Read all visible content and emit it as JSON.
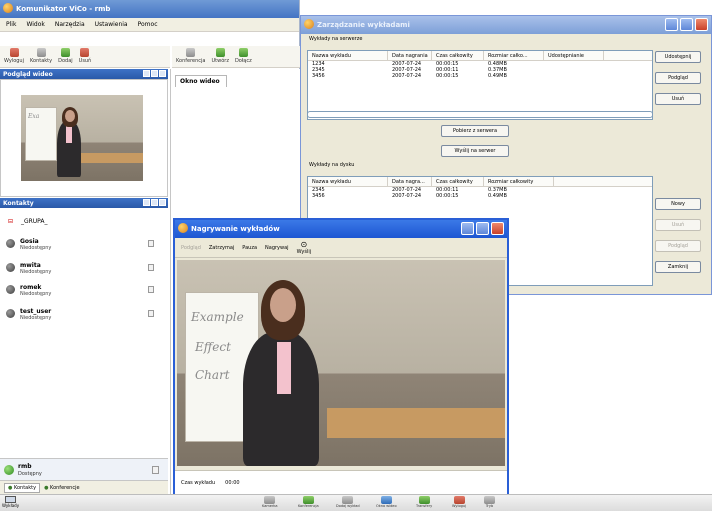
{
  "main_window": {
    "title": "Komunikator ViCo - rmb",
    "menu": [
      "Plik",
      "Widok",
      "Narzędzia",
      "Ustawienia",
      "Pomoc"
    ],
    "toolbar": [
      "Wyloguj",
      "Kontakty",
      "Dodaj",
      "Usuń",
      "Konferencja",
      "Utwórz",
      "Dołącz"
    ],
    "tab_label": "Okno wideo",
    "video_panel_title": "Podgląd wideo",
    "contacts_panel_title": "Kontakty",
    "group_label": "_GRUPA_",
    "contacts": [
      {
        "name": "Gosia",
        "status": "Niedostępny"
      },
      {
        "name": "mwita",
        "status": "Niedostępny"
      },
      {
        "name": "romek",
        "status": "Niedostępny"
      },
      {
        "name": "test_user",
        "status": "Niedostępny"
      }
    ],
    "me": {
      "name": "rmb",
      "status": "Dostępny"
    },
    "bottom_tabs": [
      "Kontakty",
      "Konferencje"
    ]
  },
  "manager": {
    "title": "Zarządzanie wykładami",
    "server_section": "Wykłady na serwerze",
    "columns_server": [
      "Nazwa wykładu",
      "Data nagrania",
      "Czas całkowity",
      "Rozmiar całko...",
      "Udostępnianie"
    ],
    "server_rows": [
      [
        "1234",
        "2007-07-24",
        "00:00:15",
        "0.48MB",
        ""
      ],
      [
        "2345",
        "2007-07-24",
        "00:00:11",
        "0.37MB",
        ""
      ],
      [
        "3456",
        "2007-07-24",
        "00:00:15",
        "0.49MB",
        ""
      ]
    ],
    "buttons_server": [
      "Udostępnij",
      "Podgląd",
      "Usuń"
    ],
    "download_button": "Pobierz z serwera",
    "send_button": "Wyślij na serwer",
    "disk_section": "Wykłady na dysku",
    "columns_disk": [
      "Nazwa wykładu",
      "Data nagra...",
      "Czas całkowity",
      "Rozmiar całkowity"
    ],
    "disk_rows": [
      [
        "2345",
        "2007-07-24",
        "00:00:11",
        "0.37MB"
      ],
      [
        "3456",
        "2007-07-24",
        "00:00:15",
        "0.49MB"
      ]
    ],
    "buttons_disk": [
      "Nowy",
      "Usuń",
      "Podgląd",
      "Zamknij"
    ]
  },
  "recording": {
    "title": "Nagrywanie wykładów",
    "tools": [
      "Podgląd",
      "Zatrzymaj",
      "Pauza",
      "Nagrywaj",
      "Wyślij"
    ],
    "time_label": "Czas wykładu",
    "time_value": "00:00",
    "slide_text": [
      "Example",
      "Effect",
      "Chart"
    ]
  },
  "taskbar": {
    "left_label": "Wykłady",
    "items": [
      "Kamerka",
      "Konferencja",
      "Dodaj wykład",
      "Okno wideo",
      "Transfery",
      "Wyloguj",
      "Tryb"
    ]
  }
}
